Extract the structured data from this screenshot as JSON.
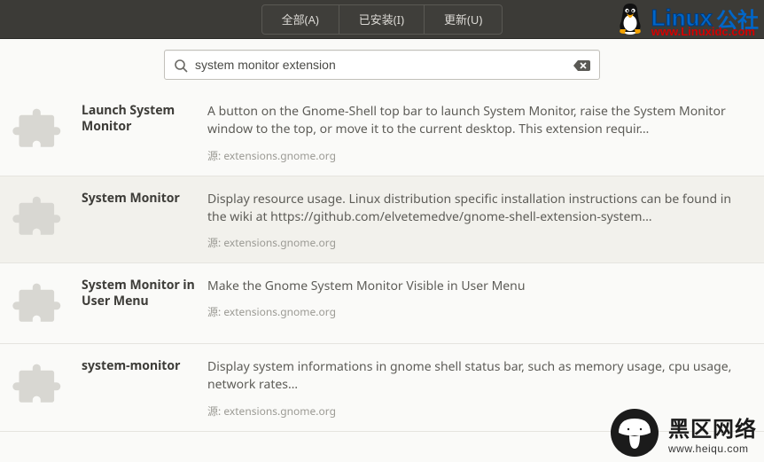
{
  "header": {
    "tabs": [
      {
        "label": "全部(A)"
      },
      {
        "label": "已安装(I)"
      },
      {
        "label": "更新(U)"
      }
    ]
  },
  "search": {
    "value": "system monitor extension"
  },
  "source_prefix": "源: ",
  "results": [
    {
      "name": "Launch System Monitor",
      "desc": "A button on the Gnome-Shell top bar to launch System Monitor, raise the System Monitor window to the top, or move it to the current desktop. This extension requir…",
      "source": "extensions.gnome.org",
      "selected": false
    },
    {
      "name": "System Monitor",
      "desc": "Display resource usage.  Linux distribution specific installation instructions can be found in the wiki at https://github.com/elvetemedve/gnome-shell-extension-system…",
      "source": "extensions.gnome.org",
      "selected": true
    },
    {
      "name": "System Monitor in User Menu",
      "desc": "Make the Gnome System Monitor Visible in User Menu",
      "source": "extensions.gnome.org",
      "selected": false
    },
    {
      "name": "system-monitor",
      "desc": "Display system informations in gnome shell status bar, such as memory usage, cpu usage, network rates…",
      "source": "extensions.gnome.org",
      "selected": false
    }
  ],
  "watermark_top": {
    "brand1": "Linux",
    "brand2": "公社",
    "url": "www.Linuxidc.com"
  },
  "watermark_bottom": {
    "brand": "黑区网络",
    "url": "www.heiqu.com"
  }
}
